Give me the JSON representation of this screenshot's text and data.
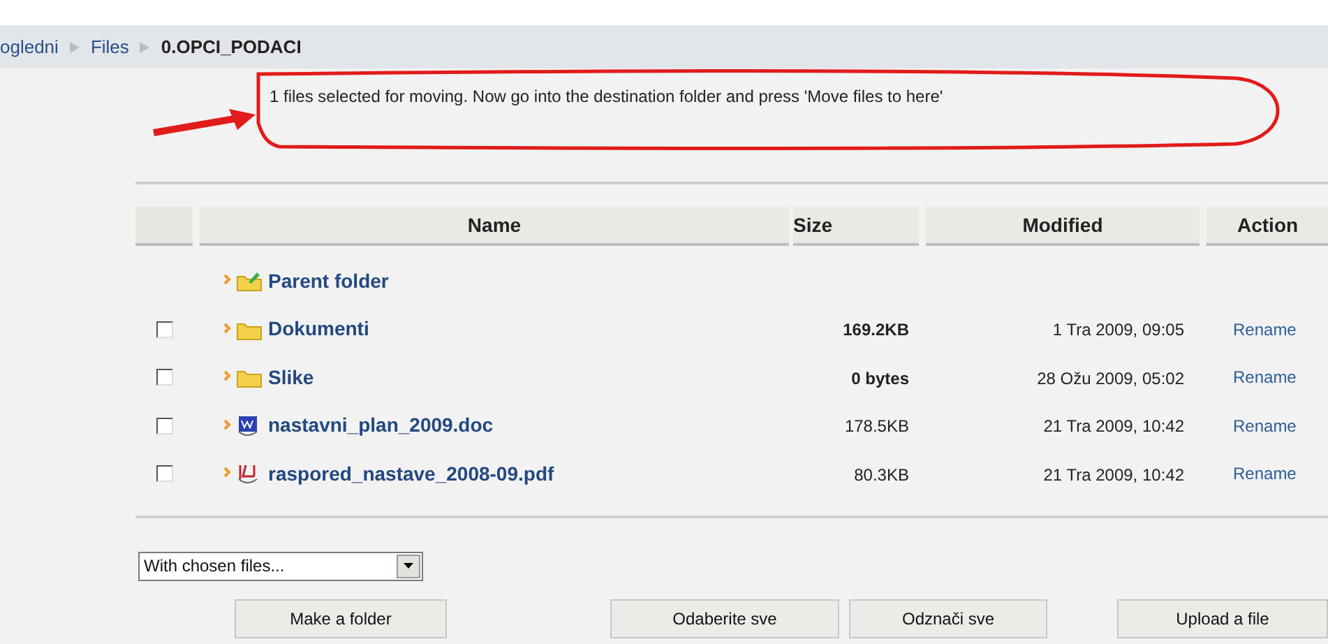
{
  "breadcrumb": [
    {
      "label": "ogledni",
      "kind": "link"
    },
    {
      "label": "Files",
      "kind": "link"
    },
    {
      "label": "0.OPCI_PODACI",
      "kind": "current"
    }
  ],
  "message": "1 files selected for moving. Now go into the destination folder and press 'Move files to here'",
  "table": {
    "columns": [
      "Name",
      "Size",
      "Modified",
      "Action"
    ],
    "rows": [
      {
        "kind": "parent",
        "name": "Parent folder"
      },
      {
        "kind": "folder",
        "checked": false,
        "name": "Dokumenti",
        "size": "169.2KB",
        "modified": "1 Tra 2009, 09:05",
        "action": "Rename"
      },
      {
        "kind": "folder",
        "checked": false,
        "name": "Slike",
        "size": "0 bytes",
        "modified": "28 Ožu 2009, 05:02",
        "action": "Rename"
      },
      {
        "kind": "doc",
        "checked": false,
        "name": "nastavni_plan_2009.doc",
        "size": "178.5KB",
        "modified": "21 Tra 2009, 10:42",
        "action": "Rename"
      },
      {
        "kind": "pdf",
        "checked": false,
        "name": "raspored_nastave_2008-09.pdf",
        "size": "80.3KB",
        "modified": "21 Tra 2009, 10:42",
        "action": "Rename"
      }
    ]
  },
  "select": {
    "value": "With chosen files..."
  },
  "buttons": [
    "Make a folder",
    "Odaberite sve",
    "Odznači sve",
    "Upload a file"
  ]
}
